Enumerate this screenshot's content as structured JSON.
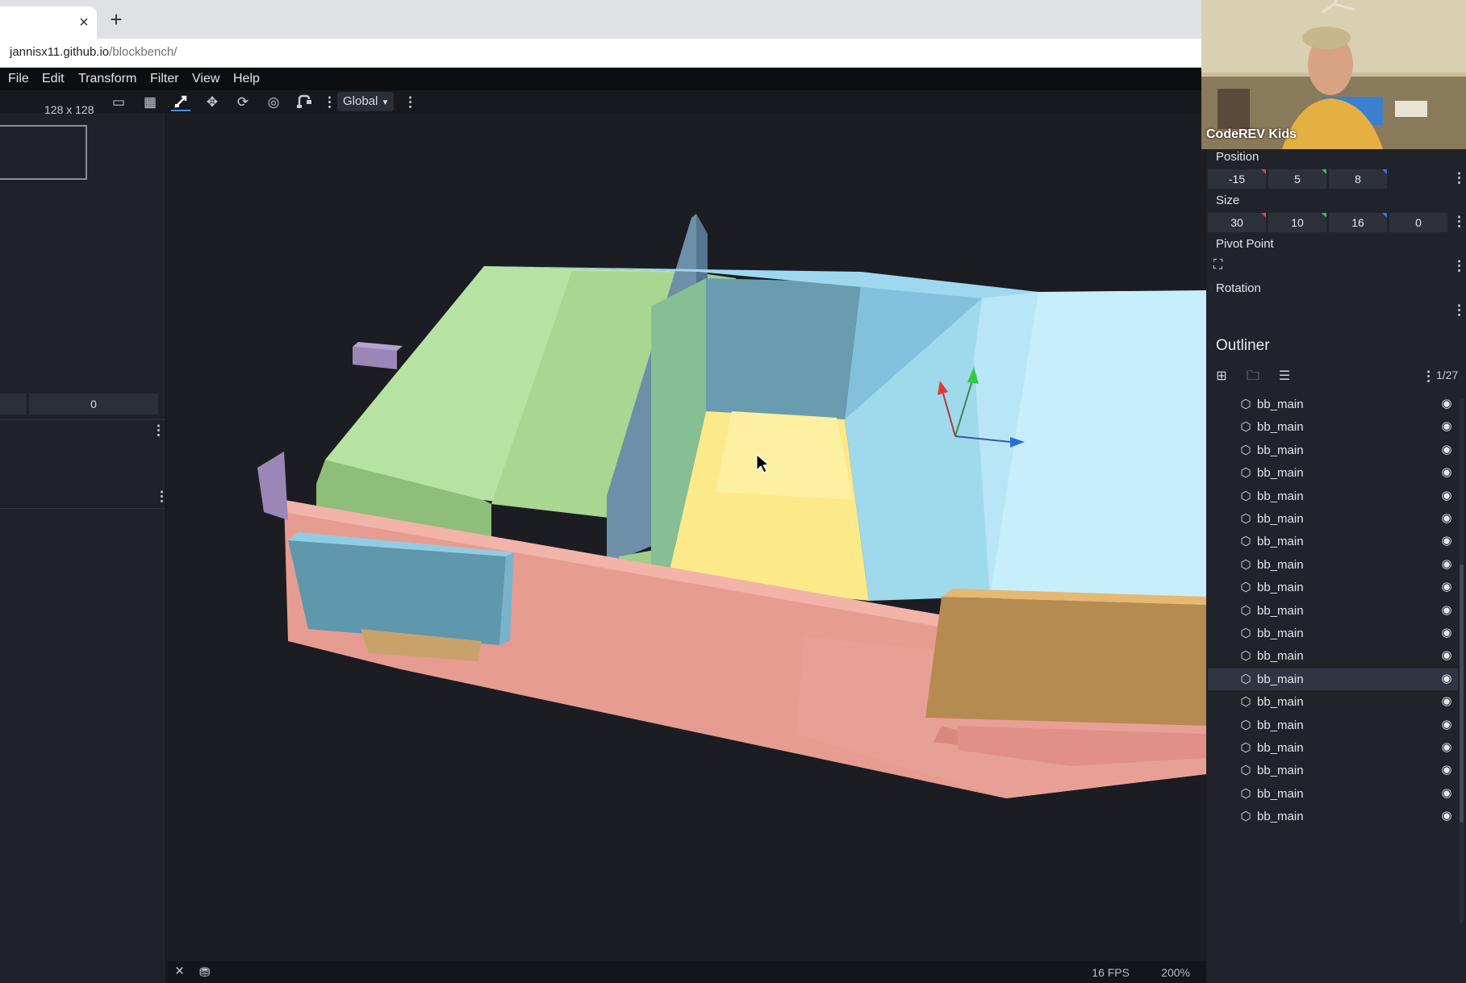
{
  "browser": {
    "tab_close": "×",
    "new_tab": "+",
    "url_host": "jannisx11.github.io",
    "url_path": "/blockbench/"
  },
  "menu": [
    "File",
    "Edit",
    "Transform",
    "Filter",
    "View",
    "Help"
  ],
  "toolbar": {
    "texture_resolution": "128 x 128",
    "space_select": "Global",
    "tools": [
      "move-tool-icon",
      "resize-tool-icon",
      "rotate-tool-icon",
      "pivot-tool-icon",
      "vertex-snap-icon"
    ]
  },
  "left_panel": {
    "field_value": "0"
  },
  "webcam": {
    "label": "CodeREV Kids"
  },
  "properties": {
    "position_label": "Position",
    "position": [
      "-15",
      "5",
      "8"
    ],
    "size_label": "Size",
    "size": [
      "30",
      "10",
      "16",
      "0"
    ],
    "pivot_label": "Pivot Point",
    "rotation_label": "Rotation",
    "axis_colors": {
      "x": "#ff3b3b",
      "y": "#2ecc40",
      "z": "#2a7cff"
    }
  },
  "outliner": {
    "title": "Outliner",
    "counter": "1/27",
    "items": [
      {
        "label": "bb_main",
        "selected": false
      },
      {
        "label": "bb_main",
        "selected": false
      },
      {
        "label": "bb_main",
        "selected": false
      },
      {
        "label": "bb_main",
        "selected": false
      },
      {
        "label": "bb_main",
        "selected": false
      },
      {
        "label": "bb_main",
        "selected": false
      },
      {
        "label": "bb_main",
        "selected": false
      },
      {
        "label": "bb_main",
        "selected": false
      },
      {
        "label": "bb_main",
        "selected": false
      },
      {
        "label": "bb_main",
        "selected": false
      },
      {
        "label": "bb_main",
        "selected": false
      },
      {
        "label": "bb_main",
        "selected": false
      },
      {
        "label": "bb_main",
        "selected": true
      },
      {
        "label": "bb_main",
        "selected": false
      },
      {
        "label": "bb_main",
        "selected": false
      },
      {
        "label": "bb_main",
        "selected": false
      },
      {
        "label": "bb_main",
        "selected": false
      },
      {
        "label": "bb_main",
        "selected": false
      },
      {
        "label": "bb_main",
        "selected": false
      }
    ]
  },
  "status": {
    "fps": "16 FPS",
    "zoom": "200%"
  },
  "colors": {
    "accent": "#3e90ff",
    "background": "#1b1d22"
  }
}
